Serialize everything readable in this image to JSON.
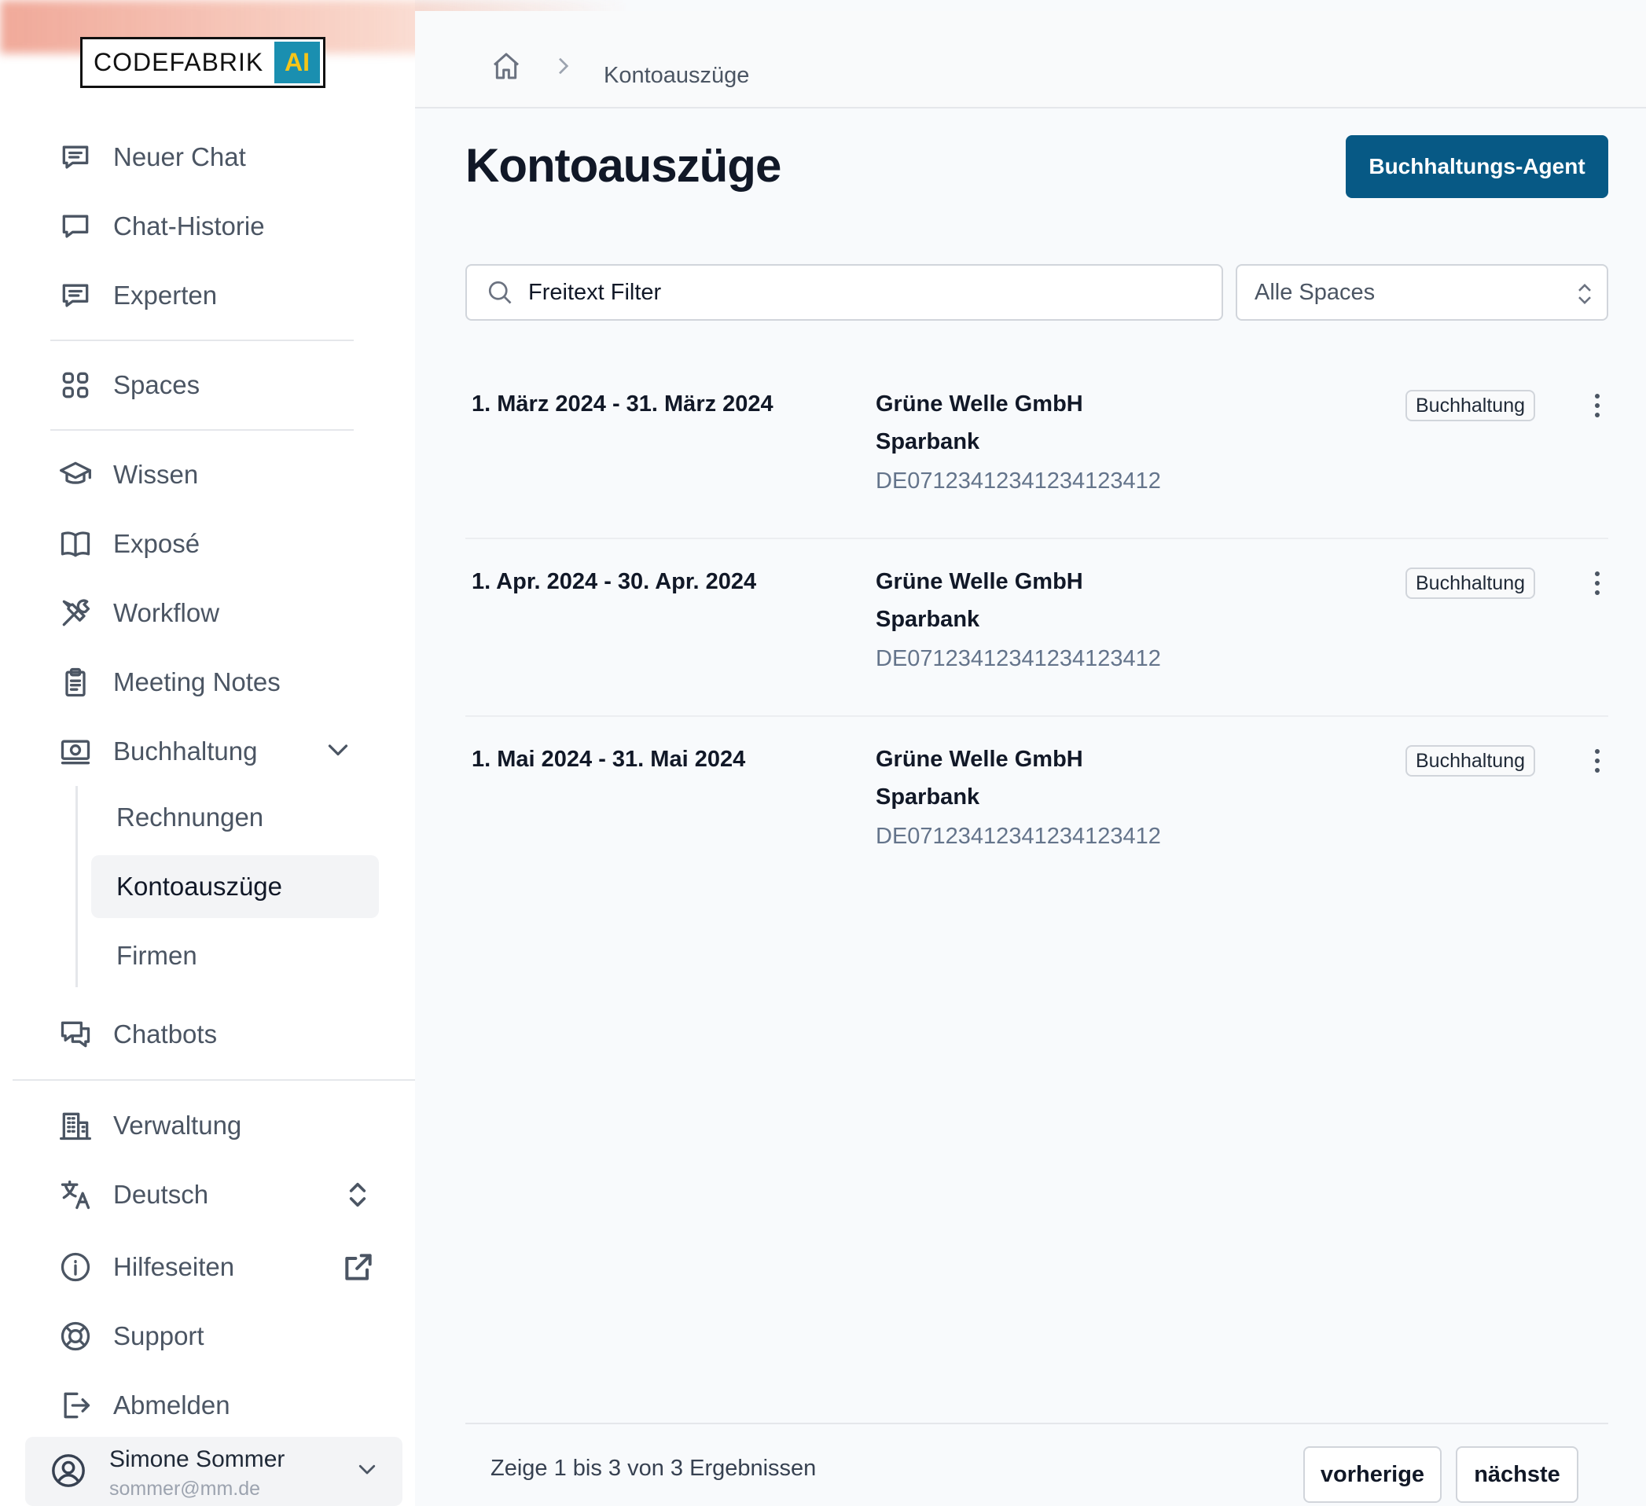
{
  "brand": {
    "name": "CODEFABRIK",
    "badge": "AI"
  },
  "sidebar": {
    "items": [
      {
        "label": "Neuer Chat",
        "icon": "chat-bubble-lines-icon"
      },
      {
        "label": "Chat-Historie",
        "icon": "chat-bubble-icon"
      },
      {
        "label": "Experten",
        "icon": "chat-bubble-lines-icon"
      },
      {
        "label": "Spaces",
        "icon": "grid-icon"
      },
      {
        "label": "Wissen",
        "icon": "graduation-cap-icon"
      },
      {
        "label": "Exposé",
        "icon": "book-open-icon"
      },
      {
        "label": "Workflow",
        "icon": "wrench-screwdriver-icon"
      },
      {
        "label": "Meeting Notes",
        "icon": "clipboard-icon"
      },
      {
        "label": "Buchhaltung",
        "icon": "banknotes-icon"
      },
      {
        "label": "Chatbots",
        "icon": "chat-bubbles-icon"
      },
      {
        "label": "Verwaltung",
        "icon": "building-icon"
      },
      {
        "label": "Deutsch",
        "icon": "language-icon"
      },
      {
        "label": "Hilfeseiten",
        "icon": "info-icon"
      },
      {
        "label": "Support",
        "icon": "lifebuoy-icon"
      },
      {
        "label": "Abmelden",
        "icon": "logout-icon"
      }
    ],
    "sub_items": [
      "Rechnungen",
      "Kontoauszüge",
      "Firmen"
    ],
    "active_sub": "Kontoauszüge"
  },
  "user": {
    "name": "Simone Sommer",
    "email": "sommer@mm.de"
  },
  "breadcrumb": {
    "current": "Kontoauszüge"
  },
  "page": {
    "title": "Kontoauszüge",
    "agent_button": "Buchhaltungs-Agent"
  },
  "filters": {
    "search_placeholder": "Freitext Filter",
    "space_select": "Alle Spaces"
  },
  "statements": [
    {
      "period": "1. März 2024 - 31. März 2024",
      "company": "Grüne Welle GmbH",
      "bank": "Sparbank",
      "iban": "DE07123412341234123412",
      "tag": "Buchhaltung"
    },
    {
      "period": "1. Apr. 2024 - 30. Apr. 2024",
      "company": "Grüne Welle GmbH",
      "bank": "Sparbank",
      "iban": "DE07123412341234123412",
      "tag": "Buchhaltung"
    },
    {
      "period": "1. Mai 2024 - 31. Mai 2024",
      "company": "Grüne Welle GmbH",
      "bank": "Sparbank",
      "iban": "DE07123412341234123412",
      "tag": "Buchhaltung"
    }
  ],
  "pagination": {
    "info": "Zeige 1 bis 3 von 3 Ergebnissen",
    "prev": "vorherige",
    "next": "nächste"
  },
  "colors": {
    "primary": "#075985",
    "logo_badge": "#1a8fb0",
    "logo_badge_text": "#f5c518"
  }
}
